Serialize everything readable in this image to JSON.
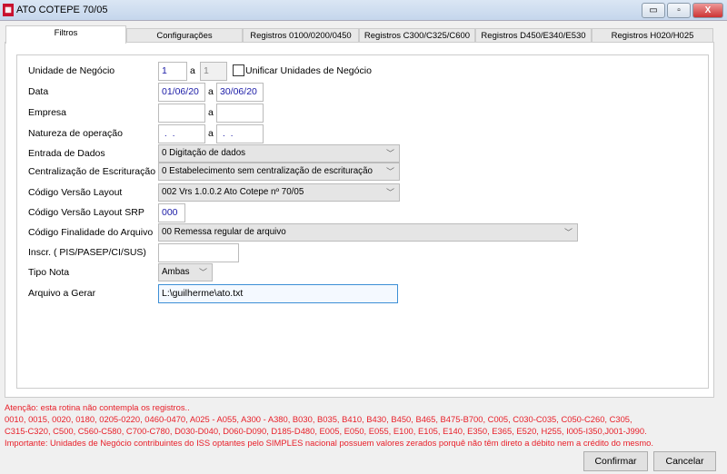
{
  "window": {
    "title": "ATO COTEPE 70/05",
    "minimize": "▭",
    "maximize": "▫",
    "close": "X"
  },
  "tabs": [
    {
      "label": "Filtros"
    },
    {
      "label": "Configurações"
    },
    {
      "label": "Registros 0100/0200/0450"
    },
    {
      "label": "Registros C300/C325/C600"
    },
    {
      "label": "Registros D450/E340/E530"
    },
    {
      "label": "Registros H020/H025"
    }
  ],
  "form": {
    "sep": "a",
    "unidade": {
      "label": "Unidade de Negócio",
      "from": "1",
      "to": "1",
      "checkbox_label": "Unificar Unidades de Negócio",
      "checked": false
    },
    "data": {
      "label": "Data",
      "from": "01/06/20",
      "to": "30/06/20"
    },
    "empresa": {
      "label": "Empresa",
      "from": "",
      "to": ""
    },
    "natureza": {
      "label": "Natureza de operação",
      "from": " .  .",
      "to": " .  ."
    },
    "entrada": {
      "label": "Entrada de Dados",
      "value": "0 Digitação de dados"
    },
    "centralizacao": {
      "label": "Centralização de Escrituração",
      "value": "0 Estabelecimento sem centralização de escrituração"
    },
    "versao": {
      "label": "Código Versão Layout",
      "value": "002 Vrs 1.0.0.2 Ato Cotepe nº 70/05"
    },
    "versao_srp": {
      "label": "Código Versão Layout SRP",
      "value": "000"
    },
    "finalidade": {
      "label": "Código Finalidade do Arquivo",
      "value": "00 Remessa regular de arquivo"
    },
    "inscr": {
      "label": "Inscr. ( PIS/PASEP/CI/SUS)",
      "value": ""
    },
    "tipo_nota": {
      "label": "Tipo Nota",
      "value": "Ambas"
    },
    "arquivo": {
      "label": "Arquivo a Gerar",
      "value": "L:\\guilherme\\ato.txt"
    }
  },
  "messages": [
    "Atenção: esta rotina não contempla os registros..",
    "0010, 0015, 0020, 0180, 0205-0220, 0460-0470, A025 - A055, A300 - A380, B030, B035, B410, B430, B450, B465, B475-B700, C005, C030-C035, C050-C260, C305,",
    "C315-C320, C500, C560-C580, C700-C780, D030-D040, D060-D090, D185-D480, E005, E050, E055, E100, E105, E140, E350, E365, E520, H255, I005-I350,J001-J990.",
    "Importante: Unidades de Negócio contribuintes do ISS optantes pelo SIMPLES nacional possuem valores zerados porquê não têm direto a débito nem a crédito do mesmo."
  ],
  "buttons": {
    "confirm": "Confirmar",
    "cancel": "Cancelar"
  },
  "colors": {
    "warning": "#e8202a",
    "input_text": "#1a1aa6",
    "focus_border": "#3c8fd6"
  }
}
